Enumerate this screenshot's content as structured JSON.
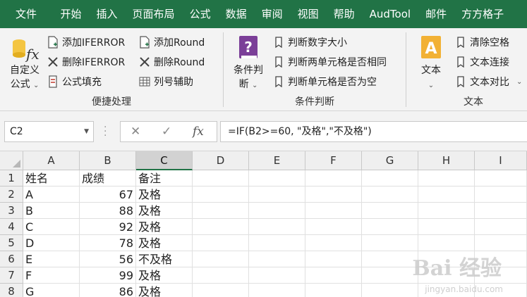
{
  "menu": {
    "tabs": [
      "文件",
      "开始",
      "插入",
      "页面布局",
      "公式",
      "数据",
      "审阅",
      "视图",
      "帮助",
      "AudTool",
      "邮件",
      "方方格子"
    ]
  },
  "ribbon": {
    "group1": {
      "title": "便捷处理",
      "big_label_line1": "自定义",
      "big_label_line2": "公式",
      "buttons": [
        "添加IFERROR",
        "删除IFERROR",
        "公式填充",
        "添加Round",
        "删除Round",
        "列号辅助"
      ]
    },
    "group2": {
      "title": "条件判断",
      "big_label_line1": "条件判",
      "big_label_line2": "断",
      "buttons": [
        "判断数字大小",
        "判断两单元格是否相同",
        "判断单元格是否为空"
      ]
    },
    "group3": {
      "title": "文本",
      "big_label": "文本",
      "buttons": [
        "清除空格",
        "文本连接",
        "文本对比"
      ]
    }
  },
  "formula_bar": {
    "name_box": "C2",
    "formula": "=IF(B2>=60, \"及格\",\"不及格\")"
  },
  "sheet": {
    "columns": [
      "A",
      "B",
      "C",
      "D",
      "E",
      "F",
      "G",
      "H",
      "I"
    ],
    "rows": [
      {
        "num": "1",
        "a": "姓名",
        "b": "成绩",
        "c": "备注"
      },
      {
        "num": "2",
        "a": "A",
        "b": "67",
        "c": "及格"
      },
      {
        "num": "3",
        "a": "B",
        "b": "88",
        "c": "及格"
      },
      {
        "num": "4",
        "a": "C",
        "b": "92",
        "c": "及格"
      },
      {
        "num": "5",
        "a": "D",
        "b": "78",
        "c": "及格"
      },
      {
        "num": "6",
        "a": "E",
        "b": "56",
        "c": "不及格"
      },
      {
        "num": "7",
        "a": "F",
        "b": "99",
        "c": "及格"
      },
      {
        "num": "8",
        "a": "G",
        "b": "86",
        "c": "及格"
      }
    ]
  },
  "watermark": {
    "main": "Bai 经验",
    "sub": "jingyan.baidu.com"
  },
  "colors": {
    "accent": "#217346",
    "ribbon_bg": "#f3f3f3"
  }
}
